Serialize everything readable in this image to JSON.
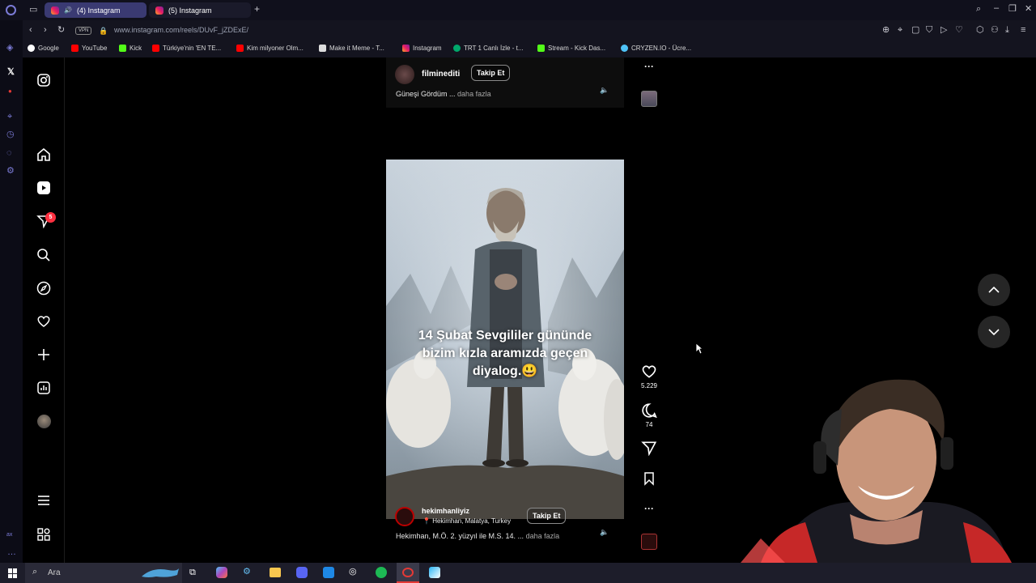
{
  "browser": {
    "tabs": [
      {
        "label": "(4) Instagram",
        "active": true
      },
      {
        "label": "(5) Instagram",
        "active": false
      }
    ],
    "url": "www.instagram.com/reels/DUvF_jZDExE/",
    "vpn_label": "VPN",
    "bookmarks": [
      {
        "label": "Google",
        "color": "#4285f4"
      },
      {
        "label": "YouTube",
        "color": "#ff0000"
      },
      {
        "label": "Kick",
        "color": "#53fc18"
      },
      {
        "label": "Türkiye'nin 'EN TE...",
        "color": "#ff0000"
      },
      {
        "label": "Kim milyoner Olm...",
        "color": "#ff0000"
      },
      {
        "label": "Make it Meme - T...",
        "color": "#ffffff"
      },
      {
        "label": "Instagram",
        "color": "#e1306c"
      },
      {
        "label": "TRT 1 Canlı İzle - t...",
        "color": "#00a86b"
      },
      {
        "label": "Stream - Kick Das...",
        "color": "#53fc18"
      },
      {
        "label": "CRYZEN.IO - Ücre...",
        "color": "#4fc3f7"
      }
    ],
    "opera_sidebar_label": "ax"
  },
  "instagram": {
    "notification_count": "5",
    "reel_top": {
      "username": "filminediti",
      "follow_label": "Takip Et",
      "caption": "Güneşi Gördüm ...",
      "more_label": "daha fazla"
    },
    "reel_main": {
      "overlay_text": "14 Şubat Sevgililer gününde bizim kızla aramızda geçen diyalog.😃",
      "username": "hekimhanliyiz",
      "location": "Hekimhan, Malatya, Turkey",
      "follow_label": "Takip Et",
      "caption": "Hekimhan, M.Ö. 2. yüzyıl ile M.S. 14. ...",
      "more_label": "daha fazla",
      "likes": "5.229",
      "comments": "74"
    }
  },
  "taskbar": {
    "search_placeholder": "Ara"
  },
  "colors": {
    "accent": "#e1306c",
    "badge": "#ff3040"
  }
}
